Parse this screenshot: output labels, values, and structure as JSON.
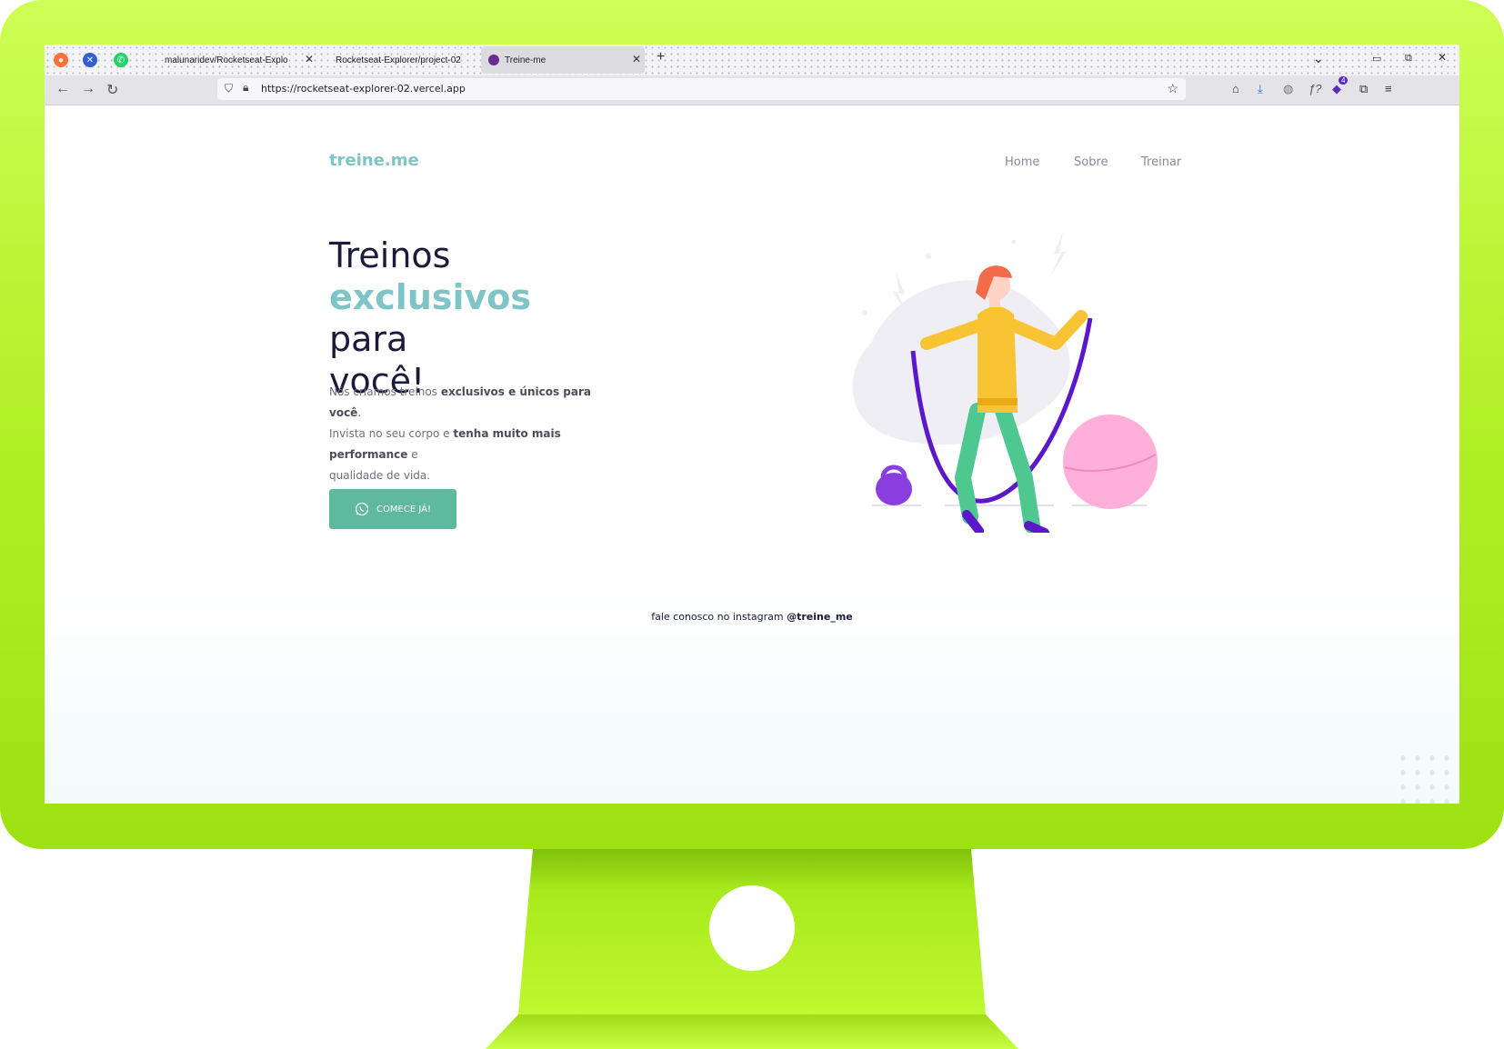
{
  "browser": {
    "tabs": [
      {
        "label": "malunaridev/Rocketseat-Explo",
        "active": false
      },
      {
        "label": "Rocketseat-Explorer/project-02",
        "active": false
      },
      {
        "label": "Treine-me",
        "active": true
      }
    ],
    "new_tab": "+",
    "close": "✕",
    "url": "https://rocketseat-explorer-02.vercel.app",
    "notification_count": "4"
  },
  "site": {
    "logo": "treine.me",
    "nav": [
      "Home",
      "Sobre",
      "Treinar"
    ],
    "hero": {
      "line1": "Treinos",
      "accent": "exclusivos",
      "line2_rest": " para",
      "line3": "você!"
    },
    "description": {
      "p1_a": "Nós criamos treinos ",
      "p1_b": "exclusivos e únicos para você",
      "p1_c": ".",
      "p2_a": "Invista no seu corpo e ",
      "p2_b": "tenha muito mais performance",
      "p2_c": " e",
      "p3": "qualidade de vida."
    },
    "cta_label": "COMECE JÁ!",
    "footer_a": "fale conosco no instagram ",
    "footer_b": "@treine_me"
  },
  "colors": {
    "accent": "#7fc4c6",
    "button": "#5fb99c",
    "dark_text": "#1b1a3a",
    "bezel": "#b4f12a"
  },
  "icons": [
    "firefox-icon",
    "jira-icon",
    "whatsapp-icon",
    "tor-icon",
    "shield-icon",
    "lock-icon",
    "star-icon",
    "home-icon",
    "download-icon",
    "extension-icon",
    "menu-icon",
    "whatsapp-icon"
  ]
}
